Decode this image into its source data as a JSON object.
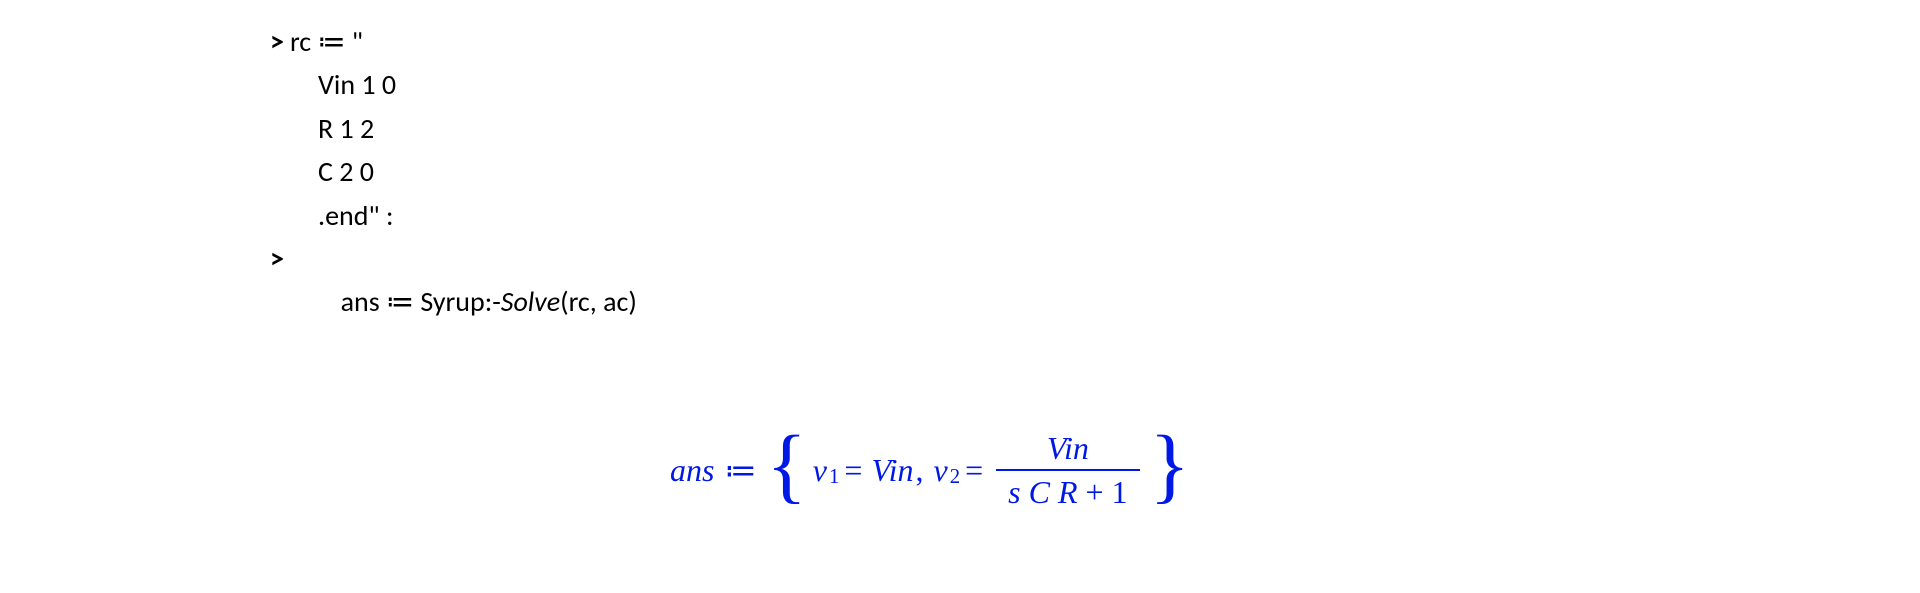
{
  "input": {
    "prompt1_gt": ">",
    "prompt2_gt": ">",
    "line1": "rc ≔ \"",
    "line2": "Vin 1 0",
    "line3": "R 1 2",
    "line4": "C 2 0",
    "line5": ".end\" :",
    "line6_prefix": "ans ≔ ",
    "line6_pkg": "Syrup:-",
    "line6_solve": "Solve",
    "line6_args": "(rc, ac)"
  },
  "output": {
    "lhs": "ans",
    "assign": "≔",
    "lbrace": "{",
    "rbrace": "}",
    "v": "v",
    "sub1": "1",
    "sub2": "2",
    "eq": "=",
    "Vin": "Vin",
    "comma": ",",
    "frac_num": "Vin",
    "den_s": "s",
    "den_C": "C",
    "den_R": "R",
    "den_plus": "+",
    "den_one": "1"
  }
}
